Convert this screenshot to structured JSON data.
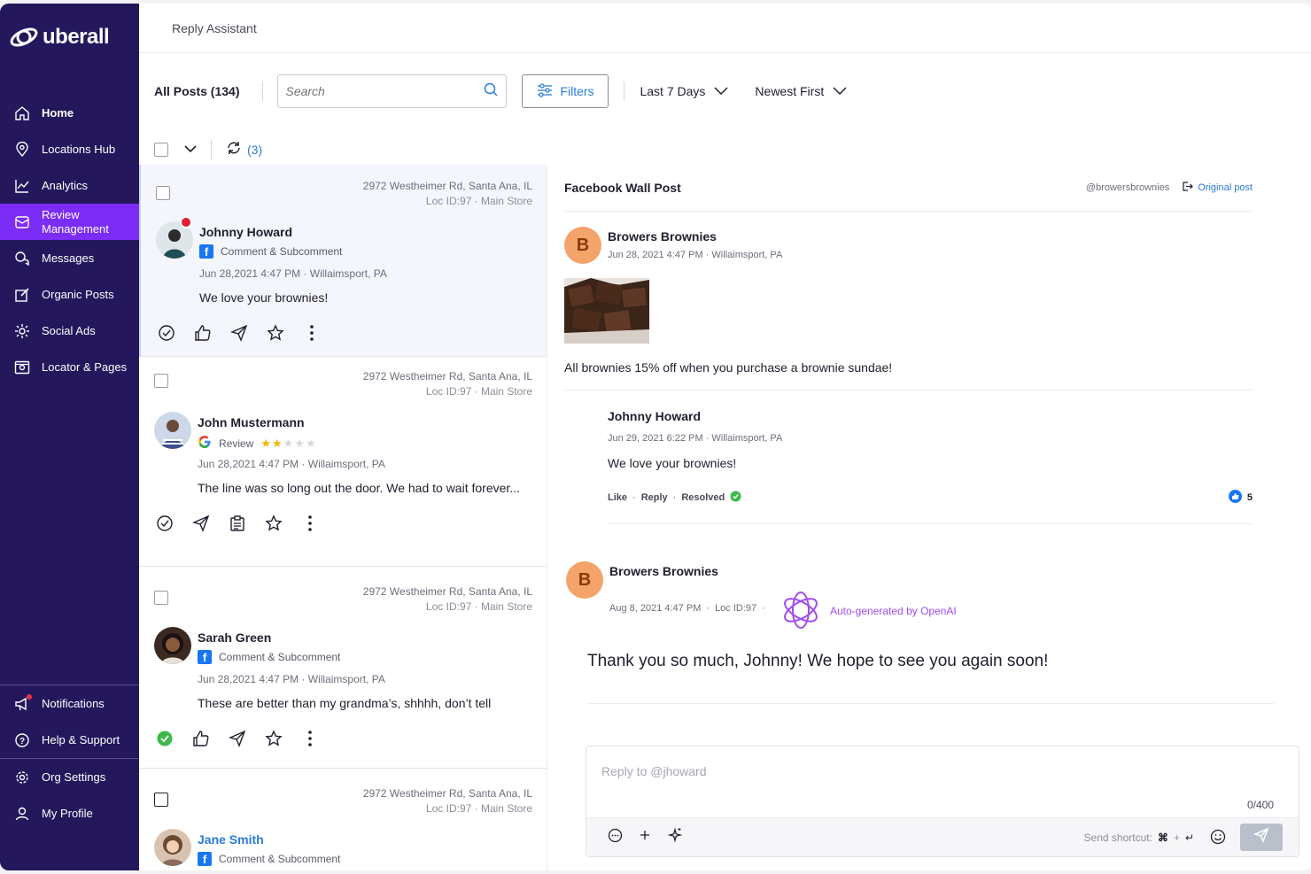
{
  "brand": {
    "name": "uberall"
  },
  "sidebar": {
    "items": [
      {
        "label": "Home",
        "icon": "home-icon"
      },
      {
        "label": "Locations Hub",
        "icon": "location-pin-icon"
      },
      {
        "label": "Analytics",
        "icon": "chart-icon"
      },
      {
        "label": "Review Management",
        "icon": "review-icon"
      },
      {
        "label": "Messages",
        "icon": "chat-icon"
      },
      {
        "label": "Organic Posts",
        "icon": "edit-icon"
      },
      {
        "label": "Social Ads",
        "icon": "sparkle-icon"
      },
      {
        "label": "Locator & Pages",
        "icon": "locator-icon"
      }
    ],
    "bottom": [
      {
        "label": "Notifications",
        "icon": "megaphone-icon"
      },
      {
        "label": "Help & Support",
        "icon": "help-icon"
      },
      {
        "label": "Org Settings",
        "icon": "gear-icon"
      },
      {
        "label": "My Profile",
        "icon": "user-icon"
      }
    ]
  },
  "topbar": {
    "title": "Reply Assistant"
  },
  "toolbar": {
    "all_posts": "All Posts (134)",
    "search_placeholder": "Search",
    "filters": "Filters",
    "date_range": "Last 7 Days",
    "sort": "Newest First",
    "refresh_count": "(3)"
  },
  "posts": [
    {
      "address": "2972 Westheimer Rd, Santa Ana, IL",
      "loc_id": "Loc ID:97",
      "store": "Main Store",
      "name": "Johnny Howard",
      "source": "Comment & Subcomment",
      "date": "Jun 28,2021 4:47 PM",
      "place": "Willaimsport, PA",
      "text": "We love your brownies!"
    },
    {
      "address": "2972 Westheimer Rd, Santa Ana, IL",
      "loc_id": "Loc ID:97",
      "store": "Main Store",
      "name": "John Mustermann",
      "source": "Review",
      "rating": 2,
      "date": "Jun 28,2021 4:47 PM",
      "place": "Willaimsport, PA",
      "text": "The line was so long out the door. We had to wait forever..."
    },
    {
      "address": "2972 Westheimer Rd, Santa Ana, IL",
      "loc_id": "Loc ID:97",
      "store": "Main Store",
      "name": "Sarah Green",
      "source": "Comment & Subcomment",
      "date": "Jun 28,2021 4:47 PM",
      "place": "Willaimsport, PA",
      "text": "These are better than my grandma’s, shhhh, don’t tell"
    },
    {
      "address": "2972 Westheimer Rd, Santa Ana, IL",
      "loc_id": "Loc ID:97",
      "store": "Main Store",
      "name": "Jane Smith",
      "source": "Comment & Subcomment"
    }
  ],
  "detail": {
    "title": "Facebook Wall Post",
    "handle": "@browersbrownies",
    "original_post": "Original post",
    "page": {
      "initial": "B",
      "name": "Browers Brownies",
      "date": "Jun 28, 2021 4:47 PM",
      "place": "Willaimsport, PA",
      "text": "All brownies 15% off when you purchase a brownie sundae!"
    },
    "comment": {
      "name": "Johnny Howard",
      "date": "Jun 29, 2021 6:22 PM",
      "place": "Willaimsport, PA",
      "text": "We love your brownies!",
      "like": "Like",
      "reply": "Reply",
      "resolved": "Resolved",
      "likes": "5"
    },
    "ai_reply": {
      "initial": "B",
      "name": "Browers Brownies",
      "date": "Aug 8, 2021 4:47 PM",
      "loc_id": "Loc ID:97",
      "label": "Auto-generated by OpenAI",
      "text": "Thank you so much, Johnny! We hope to see you again soon!"
    },
    "composer": {
      "placeholder": "Reply to @jhoward",
      "count": "0/400",
      "shortcut_label": "Send shortcut:",
      "shortcut_plus": "+"
    }
  },
  "colors": {
    "sidebar": "#24175c",
    "active": "#7b2cf5",
    "link": "#2a7bd8",
    "ai": "#a04cf0"
  }
}
